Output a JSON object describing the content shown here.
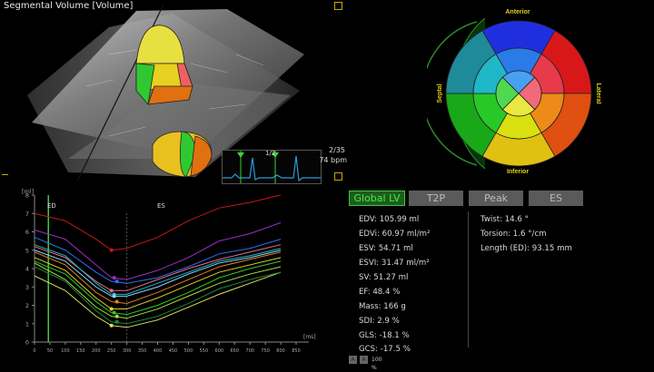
{
  "volume_panel": {
    "title": "Segmental Volume [Volume]",
    "frame_counter": "2/35",
    "bpm": "74 bpm",
    "ecg_fraction": "1/2"
  },
  "bullseye": {
    "labels": {
      "top": "Anterior",
      "bottom": "Inferior",
      "left": "Septal",
      "right": "Lateral"
    },
    "label_color": "#e0d020",
    "ring_outer": [
      "#1f2fe0",
      "#d81818",
      "#e05010",
      "#e0c010",
      "#18a818",
      "#1e8a9a"
    ],
    "ring_mid": [
      "#2a7ae8",
      "#e83a4a",
      "#ee8a18",
      "#d8e010",
      "#28c828",
      "#20b8c8"
    ],
    "ring_apex": [
      "#4aa0f0",
      "#f06a7a",
      "#e8e840",
      "#50d850"
    ]
  },
  "curves": {
    "y_axis_label": "[ml]",
    "x_axis_label": "[ms]",
    "y_ticks": [
      "8",
      "7",
      "6",
      "5",
      "4",
      "3",
      "2",
      "1",
      "0"
    ],
    "x_ticks": [
      "0",
      "50",
      "100",
      "150",
      "200",
      "250",
      "300",
      "350",
      "400",
      "450",
      "500",
      "550",
      "600",
      "650",
      "700",
      "750",
      "800",
      "850"
    ],
    "markers": {
      "ed": "ED",
      "es": "ES"
    }
  },
  "chart_data": {
    "type": "line",
    "xlabel": "[ms]",
    "ylabel": "[ml]",
    "xlim": [
      0,
      850
    ],
    "ylim": [
      0,
      8
    ],
    "ed_ms": 45,
    "es_ms": 300,
    "x": [
      0,
      100,
      200,
      250,
      300,
      400,
      500,
      600,
      700,
      800
    ],
    "series": [
      {
        "color": "#c41818",
        "values": [
          7.0,
          6.6,
          5.6,
          5.0,
          5.1,
          5.7,
          6.6,
          7.3,
          7.6,
          8.0
        ]
      },
      {
        "color": "#9b30c8",
        "values": [
          6.1,
          5.6,
          4.2,
          3.5,
          3.4,
          3.9,
          4.6,
          5.5,
          5.9,
          6.5
        ]
      },
      {
        "color": "#2f6ff0",
        "values": [
          5.7,
          5.0,
          3.8,
          3.3,
          3.2,
          3.5,
          4.1,
          4.8,
          5.1,
          5.6
        ]
      },
      {
        "color": "#f06a8a",
        "values": [
          5.2,
          4.6,
          3.3,
          2.8,
          2.8,
          3.4,
          4.0,
          4.5,
          4.9,
          5.3
        ]
      },
      {
        "color": "#20b8c8",
        "values": [
          5.3,
          4.7,
          3.2,
          2.6,
          2.6,
          3.2,
          3.8,
          4.4,
          4.7,
          5.1
        ]
      },
      {
        "color": "#e08020",
        "values": [
          4.9,
          4.2,
          2.7,
          2.2,
          2.1,
          2.7,
          3.4,
          4.1,
          4.5,
          4.9
        ]
      },
      {
        "color": "#e8d020",
        "values": [
          4.6,
          3.9,
          2.4,
          1.8,
          1.8,
          2.4,
          3.1,
          3.8,
          4.2,
          4.6
        ]
      },
      {
        "color": "#30c830",
        "values": [
          4.4,
          3.7,
          2.2,
          1.6,
          1.5,
          2.0,
          2.7,
          3.5,
          4.0,
          4.4
        ]
      },
      {
        "color": "#a8e040",
        "values": [
          4.3,
          3.4,
          1.9,
          1.4,
          1.3,
          1.8,
          2.5,
          3.2,
          3.7,
          4.1
        ]
      },
      {
        "color": "#e0e060",
        "values": [
          3.6,
          2.8,
          1.4,
          0.9,
          0.8,
          1.2,
          1.9,
          2.6,
          3.2,
          3.8
        ]
      },
      {
        "color": "#8ad8ff",
        "values": [
          5.0,
          4.4,
          3.0,
          2.5,
          2.5,
          3.0,
          3.7,
          4.3,
          4.6,
          5.0
        ]
      },
      {
        "color": "#1a8a3a",
        "values": [
          4.1,
          3.3,
          1.7,
          1.1,
          1.0,
          1.4,
          2.1,
          2.9,
          3.4,
          3.8
        ]
      }
    ]
  },
  "tabs": [
    {
      "label": "Global LV",
      "active": true
    },
    {
      "label": "T2P",
      "active": false
    },
    {
      "label": "Peak",
      "active": false
    },
    {
      "label": "ES",
      "active": false
    }
  ],
  "measurements_left": [
    "EDV: 105.99 ml",
    "EDVi: 60.97 ml/m²",
    "ESV: 54.71 ml",
    "ESVI: 31.47 ml/m²",
    "SV: 51.27 ml",
    "EF: 48.4 %",
    "Mass: 166 g",
    "SDI: 2.9 %",
    "GLS: -18.1 %",
    "GCS: -17.5 %"
  ],
  "measurements_right": [
    "Twist: 14.6 °",
    "Torsion: 1.6 °/cm",
    "Length (ED): 93.15 mm"
  ],
  "bottom_bar": {
    "btn1": "A",
    "btn2": "A",
    "zoom": "100 %"
  }
}
